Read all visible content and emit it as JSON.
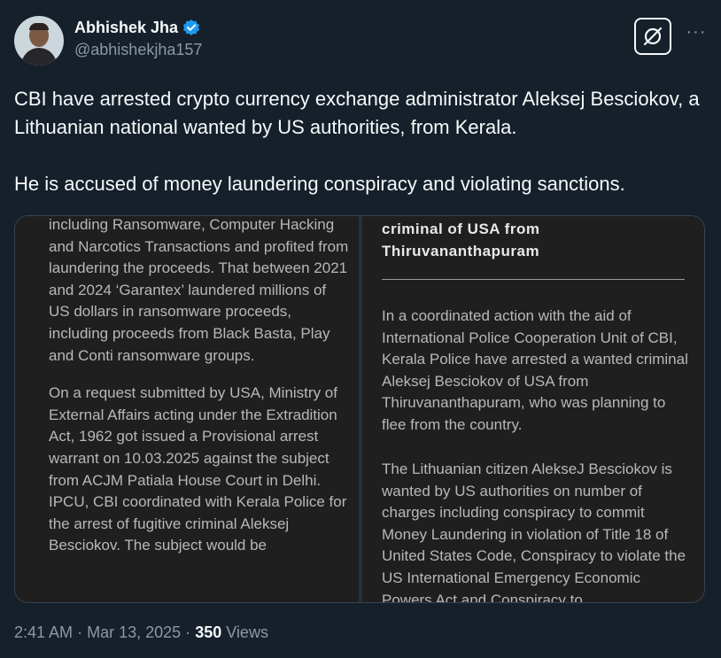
{
  "author": {
    "display_name": "Abhishek Jha",
    "handle": "@abhishekjha157",
    "verified": true,
    "verified_color": "#1d9bf0"
  },
  "tweet": {
    "paragraphs": [
      "CBI have arrested crypto currency exchange administrator Aleksej Besciokov, a Lithuanian national wanted by US authorities, from Kerala.",
      "He is accused of money laundering conspiracy and violating sanctions."
    ]
  },
  "media": {
    "left_column": {
      "para1": "including Ransomware, Computer Hacking and Narcotics Transactions and profited from laundering the proceeds. That between 2021 and 2024 ‘Garantex’ laundered millions of US dollars in ransomware proceeds, including proceeds from Black Basta, Play and Conti ransomware groups.",
      "para2": "On a request submitted by USA, Ministry of External Affairs acting under the Extradition Act, 1962 got issued a Provisional arrest warrant on 10.03.2025 against the subject from ACJM Patiala House Court in Delhi.  IPCU, CBI coordinated with Kerala Police for the arrest of fugitive criminal   Aleksej Besciokov. The subject would be"
    },
    "right_column": {
      "heading": "criminal of USA from Thiruvananthapuram",
      "para1": "In a coordinated action with the aid of International Police Cooperation Unit of CBI, Kerala Police have arrested a wanted criminal Aleksej Besciokov of USA from Thiruvananthapuram, who was planning to flee from the country.",
      "para2": "The Lithuanian citizen AlekseJ Besciokov is wanted by US authorities on number of charges including conspiracy to commit Money Laundering in violation of Title 18 of United States Code, Conspiracy to violate the US International Emergency Economic Powers Act and Conspiracy to"
    }
  },
  "meta": {
    "time": "2:41 AM",
    "separator": "·",
    "date": "Mar 13, 2025",
    "views_count": "350",
    "views_label": "Views"
  },
  "icons": {
    "grok": "grok-icon",
    "more": "more-icon"
  },
  "colors": {
    "background": "#15202b",
    "text_primary": "#f7f9f9",
    "text_secondary": "#8b98a5",
    "accent": "#1d9bf0"
  }
}
